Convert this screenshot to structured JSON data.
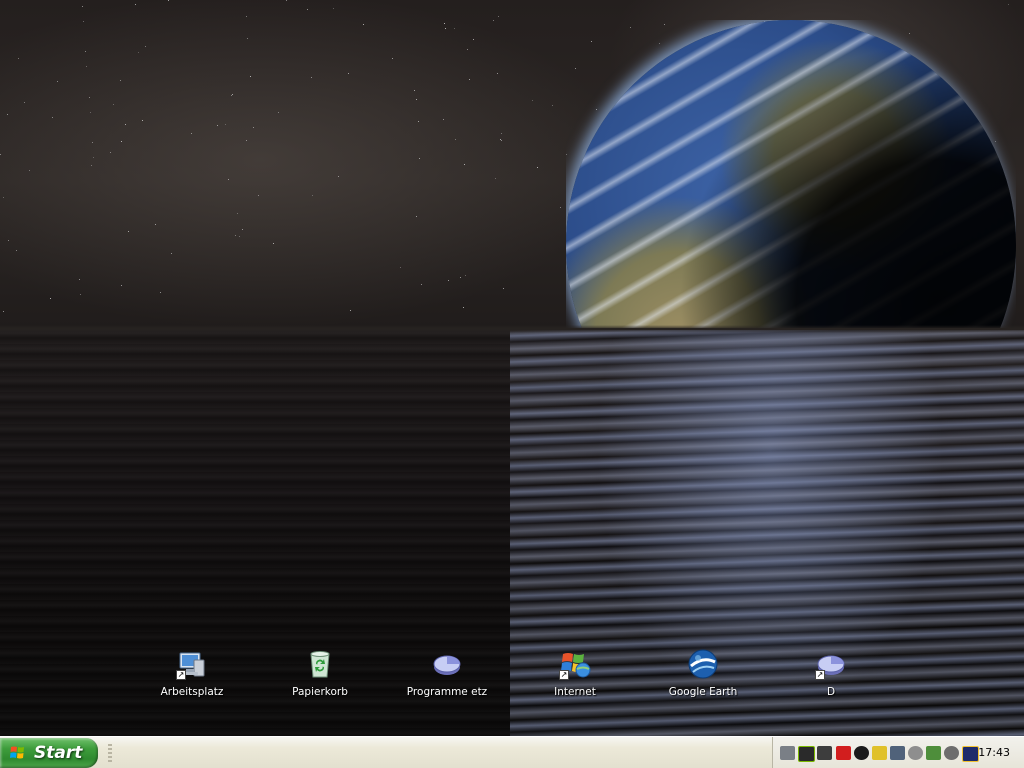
{
  "desktop": {
    "icons": [
      {
        "label": "Arbeitsplatz",
        "icon": "my-computer-icon",
        "shortcut": true
      },
      {
        "label": "Papierkorb",
        "icon": "recycle-bin-icon",
        "shortcut": false
      },
      {
        "label": "Programme etz",
        "icon": "pie-chart-icon",
        "shortcut": false
      },
      {
        "label": "Internet",
        "icon": "windows-logo-icon",
        "shortcut": true
      },
      {
        "label": "Google Earth",
        "icon": "google-earth-icon",
        "shortcut": false
      },
      {
        "label": "D",
        "icon": "pie-chart-icon",
        "shortcut": true
      }
    ]
  },
  "taskbar": {
    "start_label": "Start",
    "tray_icons": [
      "speaker-icon",
      "nvidia-icon",
      "network-icon",
      "antivirus-icon",
      "steam-icon",
      "pen-icon",
      "monitor-icon",
      "cd-icon",
      "recycle-icon",
      "webcam-icon",
      "winamp-icon"
    ],
    "clock": "17:43"
  },
  "colors": {
    "start_green": "#3e9d3c",
    "taskbar_bg": "#ece9d8",
    "icon_label": "#ffffff"
  }
}
